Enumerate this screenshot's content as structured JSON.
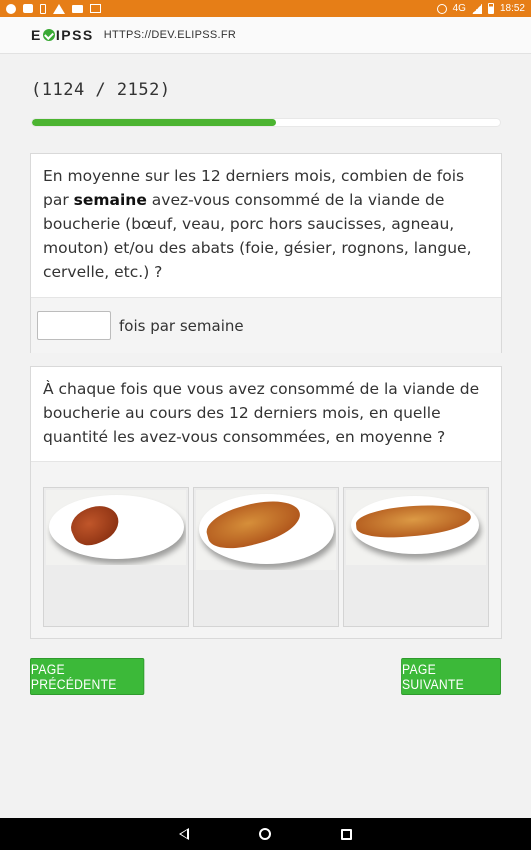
{
  "status_bar": {
    "network": "4G",
    "time": "18:52"
  },
  "header": {
    "logo_text_1": "E",
    "logo_text_2": "IPSS",
    "url": "HTTPS://DEV.ELIPSS.FR"
  },
  "progress": {
    "label": "(1124 / 2152)",
    "current": 1124,
    "total": 2152,
    "fraction": 0.522
  },
  "question1": {
    "text_before": "En moyenne sur les 12 derniers mois, combien de fois par ",
    "text_bold": "semaine",
    "text_after": " avez-vous consommé de la viande de boucherie (bœuf, veau, porc hors saucisses, agneau, mouton) et/ou des abats (foie, gésier, rognons, langue, cervelle, etc.) ?",
    "input_value": "",
    "unit_label": "fois par semaine"
  },
  "question2": {
    "text": "À chaque fois que vous avez consommé de la viande de boucherie au cours des 12 derniers mois, en quelle quantité les avez-vous consommées, en moyenne ?",
    "options": [
      {
        "id": "small"
      },
      {
        "id": "medium"
      },
      {
        "id": "large"
      }
    ]
  },
  "buttons": {
    "prev_label": "PAGE PRÉCÉDENTE",
    "next_label": "PAGE SUIVANTE"
  },
  "colors": {
    "status_bar": "#e67e17",
    "accent_green": "#3cb939",
    "progress_green": "#4cb431"
  }
}
